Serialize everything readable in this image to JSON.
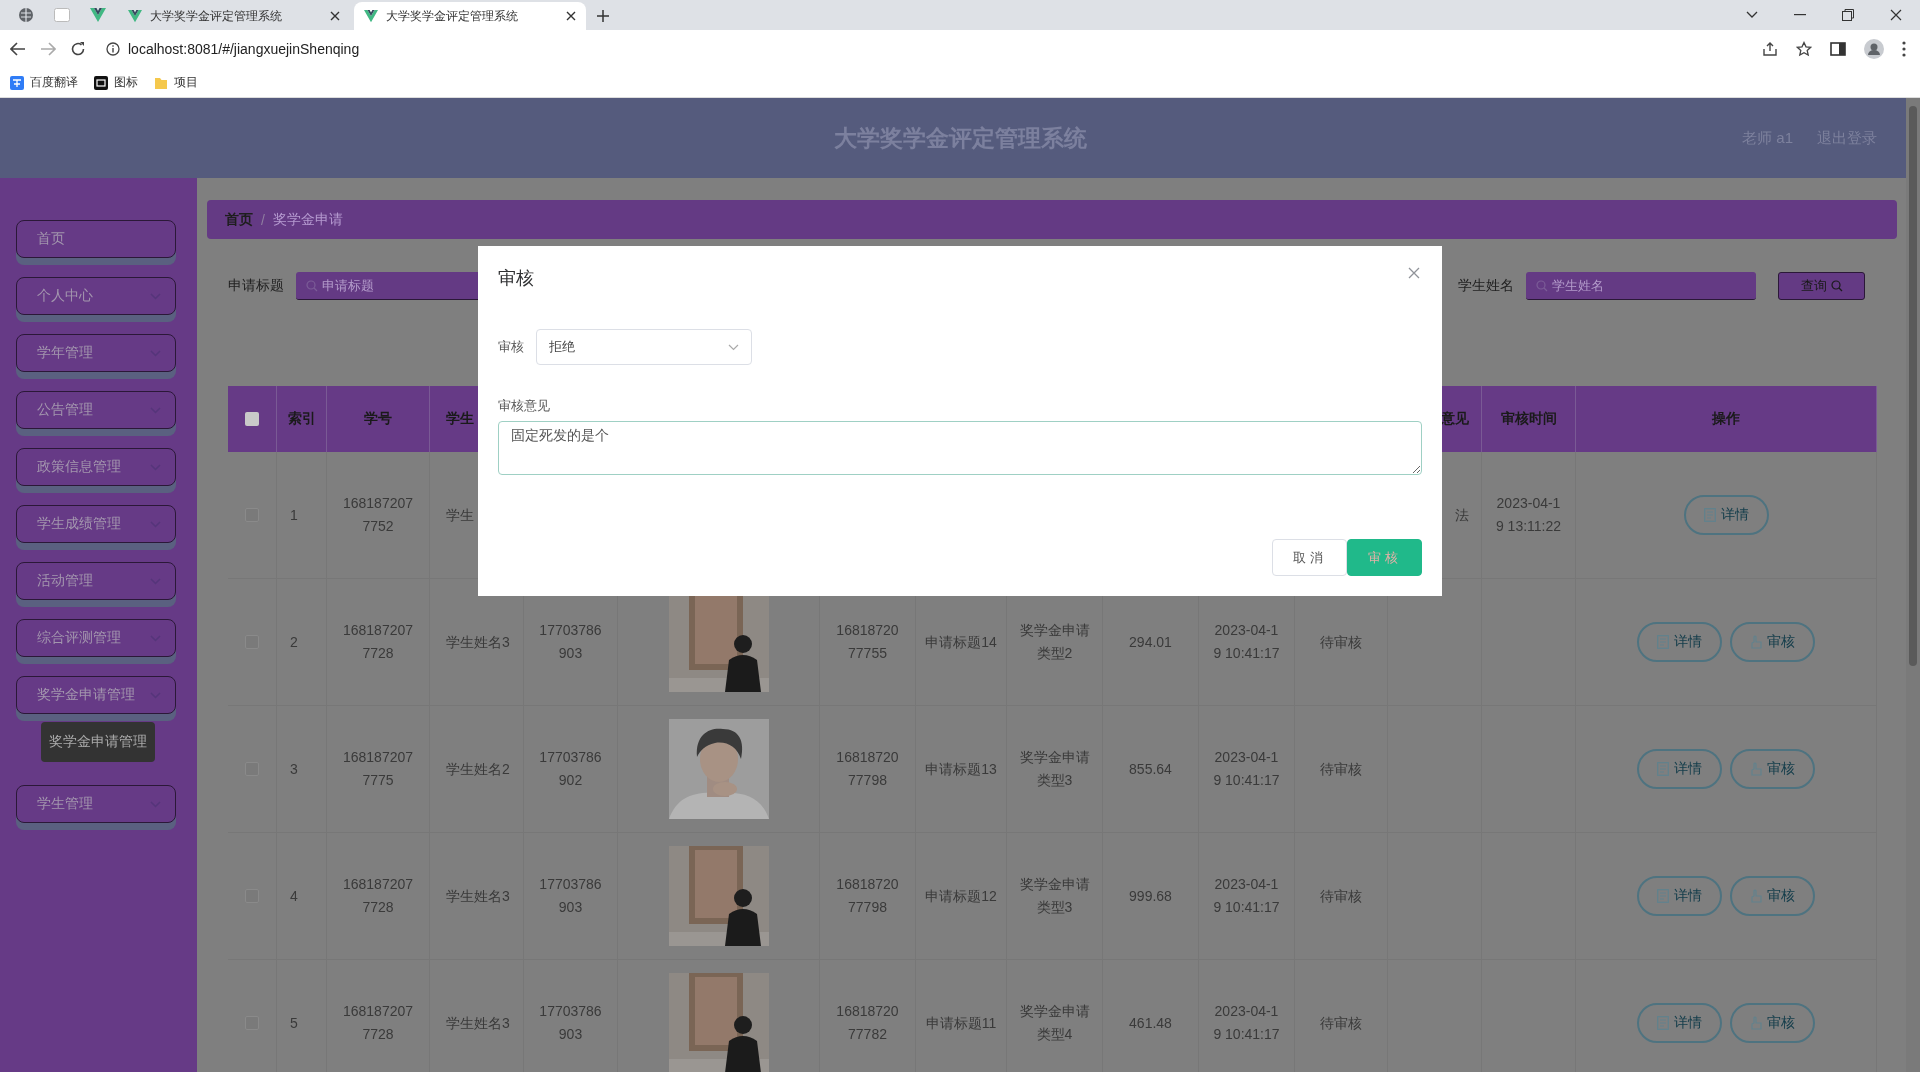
{
  "browser": {
    "tabs": [
      {
        "title": "大学奖学金评定管理系统",
        "selected": false
      },
      {
        "title": "大学奖学金评定管理系统",
        "selected": true
      }
    ],
    "url": "localhost:8081/#/jiangxuejinShenqing",
    "bookmarks": [
      {
        "label": "百度翻译",
        "kind": "translate"
      },
      {
        "label": "图标",
        "kind": "app"
      },
      {
        "label": "项目",
        "kind": "folder"
      }
    ]
  },
  "header": {
    "title": "大学奖学金评定管理系统",
    "user": "老师 a1",
    "logout": "退出登录"
  },
  "sidebar": {
    "items": [
      {
        "label": "首页",
        "kind": "link"
      },
      {
        "label": "个人中心",
        "kind": "menu"
      },
      {
        "label": "学年管理",
        "kind": "menu"
      },
      {
        "label": "公告管理",
        "kind": "menu"
      },
      {
        "label": "政策信息管理",
        "kind": "menu"
      },
      {
        "label": "学生成绩管理",
        "kind": "menu"
      },
      {
        "label": "活动管理",
        "kind": "menu"
      },
      {
        "label": "综合评测管理",
        "kind": "menu"
      },
      {
        "label": "奖学金申请管理",
        "kind": "menu",
        "children": [
          {
            "label": "奖学金申请管理"
          }
        ]
      },
      {
        "label": "学生管理",
        "kind": "menu"
      }
    ]
  },
  "breadcrumb": {
    "items": [
      "首页",
      "奖学金申请"
    ],
    "separator": "/"
  },
  "search": {
    "fields": [
      {
        "label": "申请标题",
        "placeholder": "申请标题"
      },
      {
        "label": "学生姓名",
        "placeholder": "学生姓名"
      }
    ],
    "button": "查询"
  },
  "table": {
    "select_all": {
      "checked": false
    },
    "columns": [
      "索引",
      "学号",
      "学生",
      null,
      null,
      null,
      null,
      null,
      null,
      null,
      null,
      "意见",
      "审核时间",
      "操作"
    ],
    "rows": [
      {
        "checked": false,
        "cells": [
          "1",
          "1681872077752",
          "学生",
          null,
          null,
          null,
          null,
          null,
          null,
          null,
          null,
          "法",
          "2023-04-19 13:11:22"
        ],
        "actions": [
          {
            "label": "详情",
            "kind": "detail"
          }
        ]
      },
      {
        "checked": false,
        "cells": [
          "2",
          "1681872077728",
          "学生姓名3",
          "17703786903",
          {
            "kind": "picture"
          },
          "1681872077755",
          "申请标题14",
          "奖学金申请类型2",
          "294.01",
          "2023-04-19 10:41:17",
          "待审核",
          null,
          null
        ],
        "actions": [
          {
            "label": "详情",
            "kind": "detail"
          },
          {
            "label": "审核",
            "kind": "review"
          }
        ]
      },
      {
        "checked": false,
        "cells": [
          "3",
          "1681872077775",
          "学生姓名2",
          "17703786902",
          {
            "kind": "picture"
          },
          "1681872077798",
          "申请标题13",
          "奖学金申请类型3",
          "855.64",
          "2023-04-19 10:41:17",
          "待审核",
          null,
          null
        ],
        "actions": [
          {
            "label": "详情",
            "kind": "detail"
          },
          {
            "label": "审核",
            "kind": "review"
          }
        ]
      },
      {
        "checked": false,
        "cells": [
          "4",
          "1681872077728",
          "学生姓名3",
          "17703786903",
          {
            "kind": "picture"
          },
          "1681872077798",
          "申请标题12",
          "奖学金申请类型3",
          "999.68",
          "2023-04-19 10:41:17",
          "待审核",
          null,
          null
        ],
        "actions": [
          {
            "label": "详情",
            "kind": "detail"
          },
          {
            "label": "审核",
            "kind": "review"
          }
        ]
      },
      {
        "checked": false,
        "cells": [
          "5",
          "1681872077728",
          "学生姓名3",
          "17703786903",
          {
            "kind": "picture"
          },
          "1681872077782",
          "申请标题11",
          "奖学金申请类型4",
          "461.48",
          "2023-04-19 10:41:17",
          "待审核",
          null,
          null
        ],
        "actions": [
          {
            "label": "详情",
            "kind": "detail"
          },
          {
            "label": "审核",
            "kind": "review"
          }
        ]
      }
    ]
  },
  "dialog": {
    "title": "审核",
    "fields": [
      {
        "kind": "select",
        "label": "审核",
        "value": "拒绝"
      },
      {
        "kind": "textarea",
        "label": "审核意见",
        "value": "固定死发的是个"
      }
    ],
    "buttons": [
      {
        "label": "取消",
        "kind": "secondary"
      },
      {
        "label": "审核",
        "kind": "primary"
      }
    ]
  }
}
